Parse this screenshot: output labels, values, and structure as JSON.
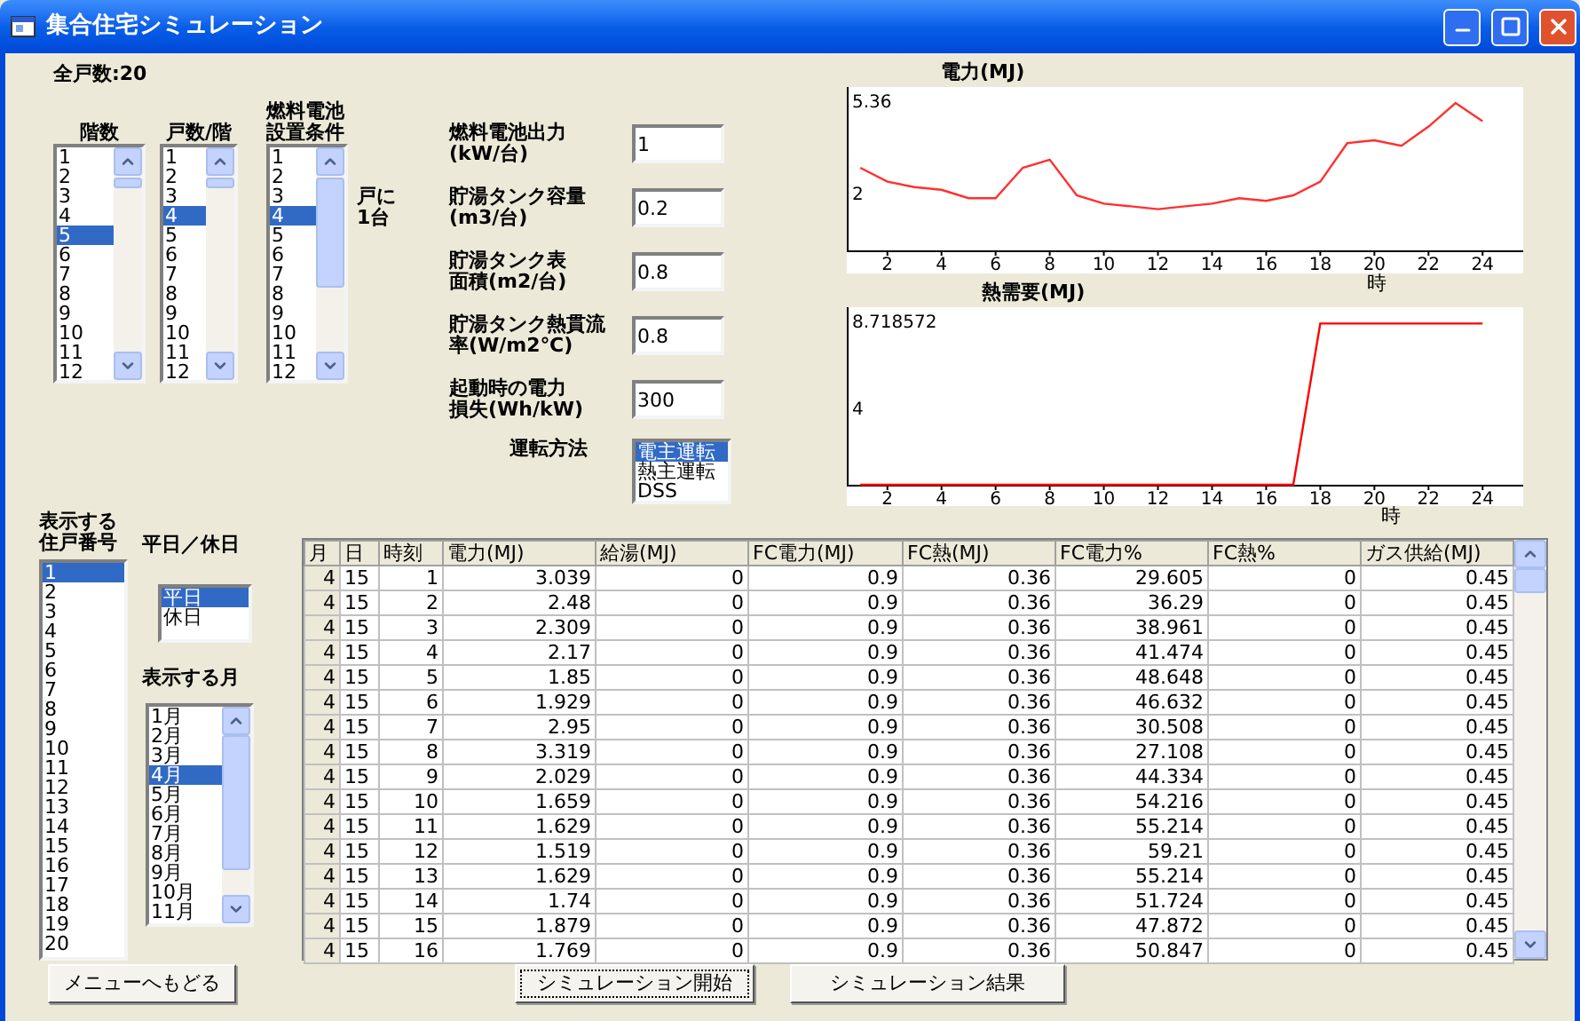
{
  "window": {
    "title": "集合住宅シミュレーション"
  },
  "total_units": "全戸数:20",
  "floors": {
    "label": "階数",
    "items": [
      {
        "text": "1",
        "selected": false
      },
      {
        "text": "2",
        "selected": false
      },
      {
        "text": "3",
        "selected": false
      },
      {
        "text": "4",
        "selected": false
      },
      {
        "text": "5",
        "selected": true
      },
      {
        "text": "6",
        "selected": false
      },
      {
        "text": "7",
        "selected": false
      },
      {
        "text": "8",
        "selected": false
      },
      {
        "text": "9",
        "selected": false
      },
      {
        "text": "10",
        "selected": false
      },
      {
        "text": "11",
        "selected": false
      },
      {
        "text": "12",
        "selected": false
      }
    ]
  },
  "units_per_floor": {
    "label": "戸数/階",
    "items": [
      {
        "text": "1",
        "selected": false
      },
      {
        "text": "2",
        "selected": false
      },
      {
        "text": "3",
        "selected": false
      },
      {
        "text": "4",
        "selected": true
      },
      {
        "text": "5",
        "selected": false
      },
      {
        "text": "6",
        "selected": false
      },
      {
        "text": "7",
        "selected": false
      },
      {
        "text": "8",
        "selected": false
      },
      {
        "text": "9",
        "selected": false
      },
      {
        "text": "10",
        "selected": false
      },
      {
        "text": "11",
        "selected": false
      },
      {
        "text": "12",
        "selected": false
      }
    ]
  },
  "fuel_cell_condition": {
    "label": "燃料電池設置条件",
    "suffix": "戸に\n1台",
    "items": [
      {
        "text": "1",
        "selected": false
      },
      {
        "text": "2",
        "selected": false
      },
      {
        "text": "3",
        "selected": false
      },
      {
        "text": "4",
        "selected": true
      },
      {
        "text": "5",
        "selected": false
      },
      {
        "text": "6",
        "selected": false
      },
      {
        "text": "7",
        "selected": false
      },
      {
        "text": "8",
        "selected": false
      },
      {
        "text": "9",
        "selected": false
      },
      {
        "text": "10",
        "selected": false
      },
      {
        "text": "11",
        "selected": false
      },
      {
        "text": "12",
        "selected": false
      }
    ]
  },
  "fields": [
    {
      "label": "燃料電池出力\n(kW/台)",
      "value": "1"
    },
    {
      "label": "貯湯タンク容量\n(m3/台)",
      "value": "0.2"
    },
    {
      "label": "貯湯タンク表面積(m2/台)",
      "value": "0.8"
    },
    {
      "label": "貯湯タンク熱貫流率(W/m2℃)",
      "value": "0.8"
    },
    {
      "label": "起動時の電力損失(Wh/kW)",
      "value": "300"
    }
  ],
  "operation": {
    "label": "運転方法",
    "items": [
      {
        "text": "電主運転",
        "selected": true
      },
      {
        "text": "熱主運転",
        "selected": false
      },
      {
        "text": "DSS",
        "selected": false
      }
    ]
  },
  "charts": [
    {
      "chart_data": {
        "type": "line",
        "title": "電力(MJ)",
        "xlabel": "時",
        "x": [
          1,
          2,
          3,
          4,
          5,
          6,
          7,
          8,
          9,
          10,
          11,
          12,
          13,
          14,
          15,
          16,
          17,
          18,
          19,
          20,
          21,
          22,
          23,
          24
        ],
        "xlim": [
          0.5,
          25.5
        ],
        "ylim": [
          0,
          5.94
        ],
        "yticks": [
          2,
          5.36
        ],
        "xticks": [
          2,
          4,
          6,
          8,
          10,
          12,
          14,
          16,
          18,
          20,
          22,
          24
        ],
        "series": [
          {
            "color": "#ff3030",
            "values": [
              3.0,
              2.5,
              2.3,
              2.2,
              1.9,
              1.9,
              3.0,
              3.3,
              2.0,
              1.7,
              1.6,
              1.5,
              1.6,
              1.7,
              1.9,
              1.8,
              2.0,
              2.5,
              3.9,
              4.0,
              3.8,
              4.5,
              5.36,
              4.7
            ]
          }
        ]
      }
    },
    {
      "chart_data": {
        "type": "line",
        "title": "熱需要(MJ)",
        "xlabel": "時",
        "x": [
          1,
          2,
          3,
          4,
          5,
          6,
          7,
          8,
          9,
          10,
          11,
          12,
          13,
          14,
          15,
          16,
          17,
          18,
          19,
          20,
          21,
          22,
          23,
          24
        ],
        "xlim": [
          0.5,
          25.5
        ],
        "ylim": [
          0,
          9.58
        ],
        "yticks": [
          4,
          8.718572
        ],
        "xticks": [
          2,
          4,
          6,
          8,
          10,
          12,
          14,
          16,
          18,
          20,
          22,
          24
        ],
        "series": [
          {
            "color": "#ff0000",
            "values": [
              0,
              0,
              0,
              0,
              0,
              0,
              0,
              0,
              0,
              0,
              0,
              0,
              0,
              0,
              0,
              0,
              0,
              8.7,
              8.7,
              8.7,
              8.7,
              8.7,
              8.7,
              8.7
            ]
          }
        ]
      }
    }
  ],
  "house_numbers": {
    "label": "表示する住戸番号",
    "items": [
      {
        "text": "1",
        "selected": true
      },
      {
        "text": "2",
        "selected": false
      },
      {
        "text": "3",
        "selected": false
      },
      {
        "text": "4",
        "selected": false
      },
      {
        "text": "5",
        "selected": false
      },
      {
        "text": "6",
        "selected": false
      },
      {
        "text": "7",
        "selected": false
      },
      {
        "text": "8",
        "selected": false
      },
      {
        "text": "9",
        "selected": false
      },
      {
        "text": "10",
        "selected": false
      },
      {
        "text": "11",
        "selected": false
      },
      {
        "text": "12",
        "selected": false
      },
      {
        "text": "13",
        "selected": false
      },
      {
        "text": "14",
        "selected": false
      },
      {
        "text": "15",
        "selected": false
      },
      {
        "text": "16",
        "selected": false
      },
      {
        "text": "17",
        "selected": false
      },
      {
        "text": "18",
        "selected": false
      },
      {
        "text": "19",
        "selected": false
      },
      {
        "text": "20",
        "selected": false
      }
    ]
  },
  "day_type": {
    "label": "平日／休日",
    "items": [
      {
        "text": "平日",
        "selected": true
      },
      {
        "text": "休日",
        "selected": false
      }
    ]
  },
  "month": {
    "label": "表示する月",
    "items": [
      {
        "text": "1月",
        "selected": false
      },
      {
        "text": "2月",
        "selected": false
      },
      {
        "text": "3月",
        "selected": false
      },
      {
        "text": "4月",
        "selected": true
      },
      {
        "text": "5月",
        "selected": false
      },
      {
        "text": "6月",
        "selected": false
      },
      {
        "text": "7月",
        "selected": false
      },
      {
        "text": "8月",
        "selected": false
      },
      {
        "text": "9月",
        "selected": false
      },
      {
        "text": "10月",
        "selected": false
      },
      {
        "text": "11月",
        "selected": false
      }
    ]
  },
  "table": {
    "columns": [
      "月",
      "日",
      "時刻",
      "電力(MJ)",
      "給湯(MJ)",
      "FC電力(MJ)",
      "FC熱(MJ)",
      "FC電力%",
      "FC熱%",
      "ガス供給(MJ)"
    ],
    "rows": [
      [
        "4",
        "15",
        "1",
        "3.039",
        "0",
        "0.9",
        "0.36",
        "29.605",
        "0",
        "0.45"
      ],
      [
        "4",
        "15",
        "2",
        "2.48",
        "0",
        "0.9",
        "0.36",
        "36.29",
        "0",
        "0.45"
      ],
      [
        "4",
        "15",
        "3",
        "2.309",
        "0",
        "0.9",
        "0.36",
        "38.961",
        "0",
        "0.45"
      ],
      [
        "4",
        "15",
        "4",
        "2.17",
        "0",
        "0.9",
        "0.36",
        "41.474",
        "0",
        "0.45"
      ],
      [
        "4",
        "15",
        "5",
        "1.85",
        "0",
        "0.9",
        "0.36",
        "48.648",
        "0",
        "0.45"
      ],
      [
        "4",
        "15",
        "6",
        "1.929",
        "0",
        "0.9",
        "0.36",
        "46.632",
        "0",
        "0.45"
      ],
      [
        "4",
        "15",
        "7",
        "2.95",
        "0",
        "0.9",
        "0.36",
        "30.508",
        "0",
        "0.45"
      ],
      [
        "4",
        "15",
        "8",
        "3.319",
        "0",
        "0.9",
        "0.36",
        "27.108",
        "0",
        "0.45"
      ],
      [
        "4",
        "15",
        "9",
        "2.029",
        "0",
        "0.9",
        "0.36",
        "44.334",
        "0",
        "0.45"
      ],
      [
        "4",
        "15",
        "10",
        "1.659",
        "0",
        "0.9",
        "0.36",
        "54.216",
        "0",
        "0.45"
      ],
      [
        "4",
        "15",
        "11",
        "1.629",
        "0",
        "0.9",
        "0.36",
        "55.214",
        "0",
        "0.45"
      ],
      [
        "4",
        "15",
        "12",
        "1.519",
        "0",
        "0.9",
        "0.36",
        "59.21",
        "0",
        "0.45"
      ],
      [
        "4",
        "15",
        "13",
        "1.629",
        "0",
        "0.9",
        "0.36",
        "55.214",
        "0",
        "0.45"
      ],
      [
        "4",
        "15",
        "14",
        "1.74",
        "0",
        "0.9",
        "0.36",
        "51.724",
        "0",
        "0.45"
      ],
      [
        "4",
        "15",
        "15",
        "1.879",
        "0",
        "0.9",
        "0.36",
        "47.872",
        "0",
        "0.45"
      ],
      [
        "4",
        "15",
        "16",
        "1.769",
        "0",
        "0.9",
        "0.36",
        "50.847",
        "0",
        "0.45"
      ]
    ]
  },
  "buttons": [
    {
      "label": "メニューへもどる",
      "focused": false
    },
    {
      "label": "シミュレーション開始",
      "focused": true
    },
    {
      "label": "シミュレーション結果",
      "focused": false
    }
  ]
}
